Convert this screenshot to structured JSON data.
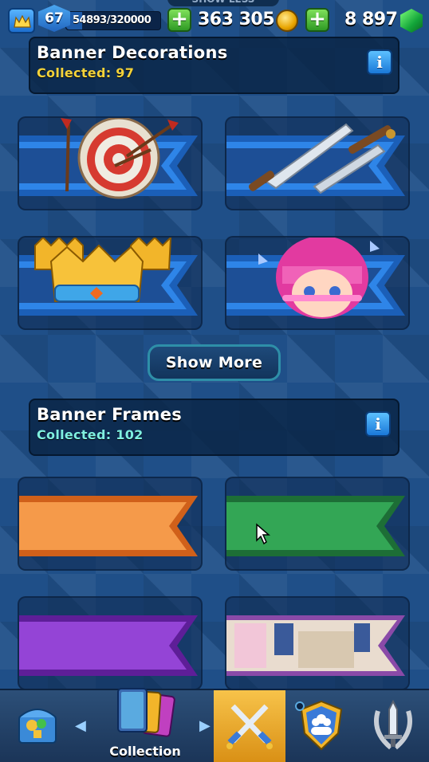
{
  "top_bar": {
    "peek_label": "SHOW LESS",
    "level": "67",
    "xp": "54893/320000",
    "xp_progress": 0.17,
    "gold_amount": "363 305",
    "gem_amount": "8 897"
  },
  "banner_decorations": {
    "title": "Banner Decorations",
    "collected": "Collected: 97",
    "info_label": "i"
  },
  "decorations": [
    {
      "item": "archery-target-decoration"
    },
    {
      "item": "swords-decoration"
    },
    {
      "item": "crowns-decoration"
    },
    {
      "item": "pink-haired-character-decoration"
    }
  ],
  "show_more_label": "Show More",
  "banner_frames": {
    "title": "Banner Frames",
    "collected": "Collected: 102",
    "info_label": "i"
  },
  "frames": [
    {
      "item": "orange-frame",
      "color": "#f08a3a"
    },
    {
      "item": "green-frame",
      "color": "#2e9b4e"
    },
    {
      "item": "purple-frame",
      "color": "#8a36c8"
    },
    {
      "item": "castle-art-frame",
      "color": "#a870c0"
    }
  ],
  "bottom_nav": {
    "tabs": [
      {
        "name": "shop",
        "icon": "treasure-chest-icon"
      },
      {
        "name": "collection",
        "icon": "cards-icon",
        "label": "Collection"
      },
      {
        "name": "battle",
        "icon": "crossed-swords-icon"
      },
      {
        "name": "clan",
        "icon": "clan-shield-icon"
      },
      {
        "name": "events",
        "icon": "sword-laurel-icon"
      }
    ],
    "active": "battle"
  },
  "colors": {
    "collected_gold": "#f3d23a",
    "collected_cyan": "#7ff0e0",
    "ribbon_blue": "#2b7fe0",
    "accent_gold": "#f7c34a"
  }
}
